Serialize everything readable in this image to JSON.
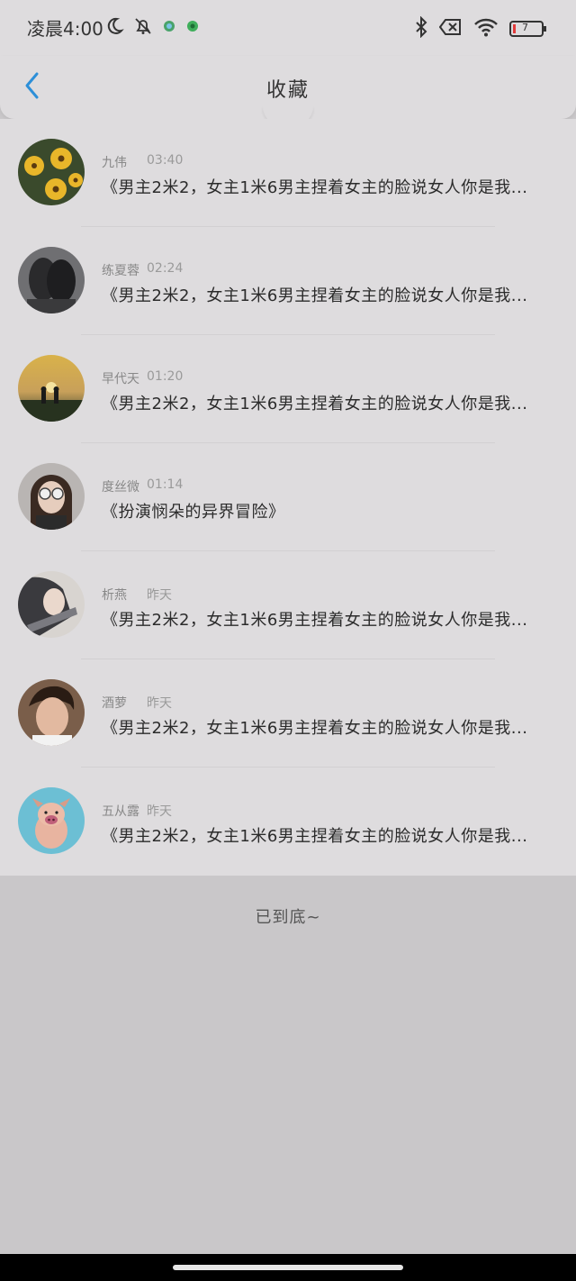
{
  "status": {
    "time": "凌晨4:00",
    "battery": "7"
  },
  "header": {
    "title": "收藏"
  },
  "items": [
    {
      "name": "九伟",
      "time": "03:40",
      "text": "《男主2米2，女主1米6男主捏着女主的脸说女人你是我..."
    },
    {
      "name": "练夏蓉",
      "time": "02:24",
      "text": "《男主2米2，女主1米6男主捏着女主的脸说女人你是我..."
    },
    {
      "name": "早代天",
      "time": "01:20",
      "text": "《男主2米2，女主1米6男主捏着女主的脸说女人你是我..."
    },
    {
      "name": "度丝微",
      "time": "01:14",
      "text": "《扮演悯朵的异界冒险》"
    },
    {
      "name": "析燕",
      "time": "昨天",
      "text": "《男主2米2，女主1米6男主捏着女主的脸说女人你是我..."
    },
    {
      "name": "酒萝",
      "time": "昨天",
      "text": "《男主2米2，女主1米6男主捏着女主的脸说女人你是我..."
    },
    {
      "name": "五从露",
      "time": "昨天",
      "text": "《男主2米2，女主1米6男主捏着女主的脸说女人你是我..."
    }
  ],
  "footer": {
    "end_text": "已到底~"
  },
  "colors": {
    "accent": "#2d8fd8",
    "background": "#c9c7c9",
    "surface": "#dedcde"
  },
  "icons": [
    "moon-icon",
    "bell-off-icon",
    "app-icon",
    "bluetooth-icon",
    "sim-error-icon",
    "wifi-icon",
    "battery-icon",
    "back-arrow-icon"
  ]
}
